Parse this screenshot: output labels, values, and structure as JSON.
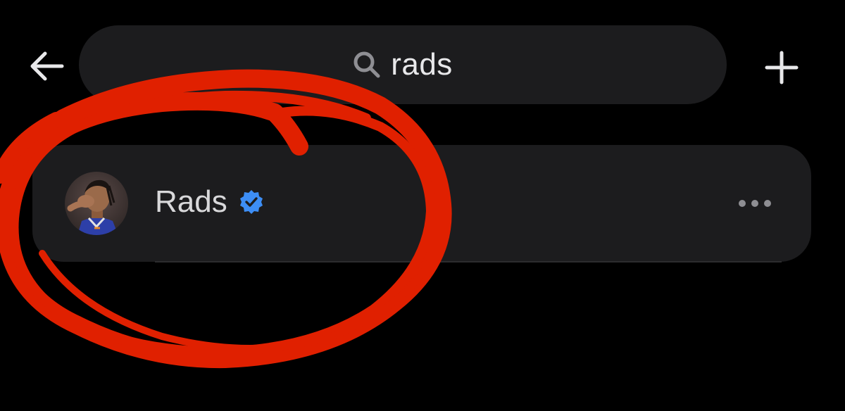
{
  "header": {
    "back_icon": "arrow-left-icon",
    "add_icon": "plus-icon"
  },
  "search": {
    "icon": "search-icon",
    "query": "rads"
  },
  "result": {
    "name": "Rads",
    "verified": true,
    "verified_icon": "verified-badge-icon",
    "avatar": "player-avatar",
    "more_icon": "more-horizontal-icon"
  },
  "annotation": {
    "type": "hand-drawn circle",
    "color": "#e02000"
  },
  "colors": {
    "background": "#000000",
    "surface": "#1c1c1e",
    "text_primary": "#e8e8ea",
    "icon_gray": "#8e8e93",
    "verified_blue": "#3d8ef6"
  }
}
